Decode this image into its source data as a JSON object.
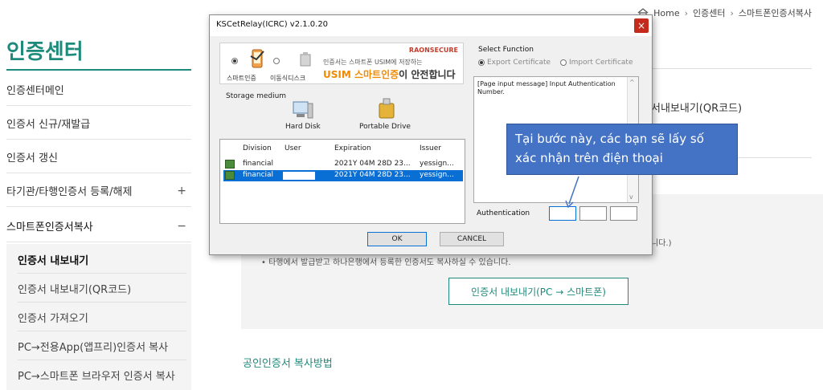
{
  "breadcrumb": [
    "Home",
    "인증센터",
    "스마트폰인증서복사"
  ],
  "sidebar": {
    "title": "인증센터",
    "items": [
      {
        "label": "인증센터메인",
        "sign": ""
      },
      {
        "label": "인증서 신규/재발급",
        "sign": ""
      },
      {
        "label": "인증서 갱신",
        "sign": ""
      },
      {
        "label": "타기관/타행인증서 등록/해제",
        "sign": "+"
      },
      {
        "label": "스마트폰인증서복사",
        "sign": "−"
      }
    ],
    "subitems": [
      "인증서 내보내기",
      "인증서 내보내기(QR코드)",
      "인증서 가져오기",
      "PC→전용App(앱프리)인증서 복사",
      "PC→스마트폰 브라우저 인증서 복사"
    ]
  },
  "main": {
    "qr_label": "서내보내기(QR코드)",
    "notice1": "니다.)",
    "notice2": "• 타행에서 발급받고 하나은행에서 등록한 인증서도 복사하실 수 있습니다.",
    "export_button": "인증서 내보내기(PC → 스마트폰)",
    "copy_method": "공인인증서 복사방법"
  },
  "dialog": {
    "title": "KSCetRelay(ICRC) v2.1.0.20",
    "close": "×",
    "banner": {
      "opt1": "스마트인증",
      "opt2": "이동식디스크",
      "brand": "RAONSECURE",
      "small": "인증서는 스마트폰 USIM에 저장하는",
      "big_orange": "USIM 스마트인증",
      "big_rest": "이 안전합니다"
    },
    "storage": {
      "label": "Storage medium",
      "hard_disk": "Hard Disk",
      "portable": "Portable Drive"
    },
    "table": {
      "headers": [
        "Division",
        "User",
        "Expiration",
        "Issuer"
      ],
      "rows": [
        {
          "division": "financial",
          "user": "",
          "expiration": "2021Y 04M 28D 23...",
          "issuer": "yessign..."
        },
        {
          "division": "financial",
          "user": "",
          "expiration": "2021Y 04M 28D 23...",
          "issuer": "yessign..."
        }
      ]
    },
    "function": {
      "label": "Select Function",
      "export": "Export Certificate",
      "import": "Import Certificate"
    },
    "message": "[Page input message]  Input Authentication Number.",
    "auth_label": "Authentication",
    "ok": "OK",
    "cancel": "CANCEL"
  },
  "callout": {
    "line1": "Tại bước này, các bạn sẽ lấy số",
    "line2": "xác nhận trên điện thoại"
  }
}
